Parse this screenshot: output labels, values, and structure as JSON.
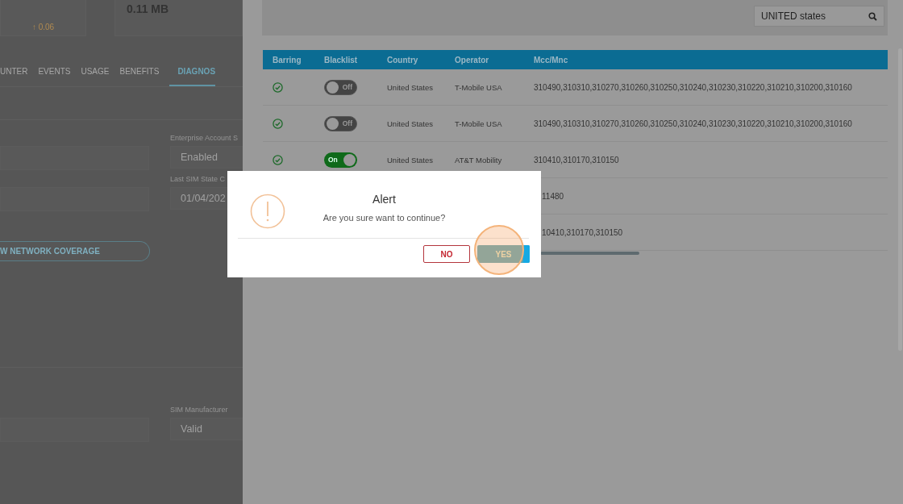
{
  "page": {
    "stats": [
      {
        "value": "↑ 0.06",
        "kind": "delta"
      },
      {
        "value": "0.11 MB",
        "kind": "total"
      }
    ],
    "tabs": [
      {
        "label": "UNTER",
        "selected": false
      },
      {
        "label": "EVENTS",
        "selected": false
      },
      {
        "label": "USAGE",
        "selected": false
      },
      {
        "label": "BENEFITS",
        "selected": false
      },
      {
        "label": "DIAGNOS",
        "selected": true
      }
    ],
    "fields": [
      {
        "label": "Enterprise Account S",
        "value": "Enabled"
      },
      {
        "label": "Last SIM State C",
        "value": "01/04/202"
      }
    ],
    "coverage_button": "W NETWORK COVERAGE",
    "lower_fields": [
      {
        "label": "SIM Manufacturer",
        "value": "Valid"
      }
    ]
  },
  "panel": {
    "search": {
      "value": "UNITED states"
    },
    "table": {
      "columns": [
        "Barring",
        "Blacklist",
        "Country",
        "Operator",
        "Mcc/Mnc"
      ],
      "rows": [
        {
          "barring": true,
          "blacklist": {
            "on": false,
            "label": "Off"
          },
          "country": "United States",
          "operator": "T-Mobile USA",
          "mcc_mnc": "310490,310310,310270,310260,310250,310240,310230,310220,310210,310200,310160"
        },
        {
          "barring": true,
          "blacklist": {
            "on": false,
            "label": "Off"
          },
          "country": "United States",
          "operator": "T-Mobile USA",
          "mcc_mnc": "310490,310310,310270,310260,310250,310240,310230,310220,310210,310200,310160"
        },
        {
          "barring": true,
          "blacklist": {
            "on": true,
            "label": "On"
          },
          "country": "United States",
          "operator": "AT&T Mobility",
          "mcc_mnc": "310410,310170,310150"
        },
        {
          "mcc_mnc": "11480"
        },
        {
          "mcc_mnc": "10410,310170,310150"
        }
      ]
    }
  },
  "dialog": {
    "title": "Alert",
    "message": "Are you sure want to continue?",
    "buttons": [
      {
        "label": "NO",
        "kind": "secondary"
      },
      {
        "label": "YES",
        "kind": "primary"
      }
    ]
  }
}
